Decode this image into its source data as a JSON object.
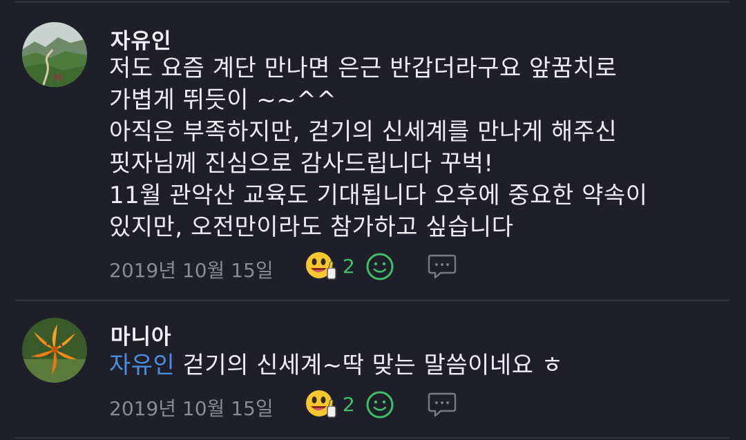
{
  "comments": [
    {
      "author": "자유인",
      "avatar": "mountain-trail-photo",
      "lines": [
        "저도 요즘 계단 만나면 은근 반갑더라구요 앞꿈치로",
        "가볍게 뛰듯이 ~~^^",
        "아직은 부족하지만, 걷기의 신세계를 만나게 해주신",
        "핏자님께 진심으로 감사드립니다 꾸벅!",
        "11월 관악산 교육도 기대됩니다 오후에 중요한 약속이",
        "있지만, 오전만이라도 참가하고 싶습니다"
      ],
      "date": "2019년 10월 15일",
      "reaction_icon": "thumbs-up-smiley-emoji",
      "reaction_count": "2"
    },
    {
      "author": "마니아",
      "avatar": "orange-lily-photo",
      "mention": "자유인",
      "text": " 걷기의 신세계~딱 맞는 말씀이네요 ㅎ",
      "date": "2019년 10월 15일",
      "reaction_icon": "thumbs-up-smiley-emoji",
      "reaction_count": "2"
    }
  ],
  "colors": {
    "background": "#1f1f29",
    "mention": "#4b8fe0",
    "reaction_count": "#3fbf6a",
    "muted": "#8b8b95"
  }
}
